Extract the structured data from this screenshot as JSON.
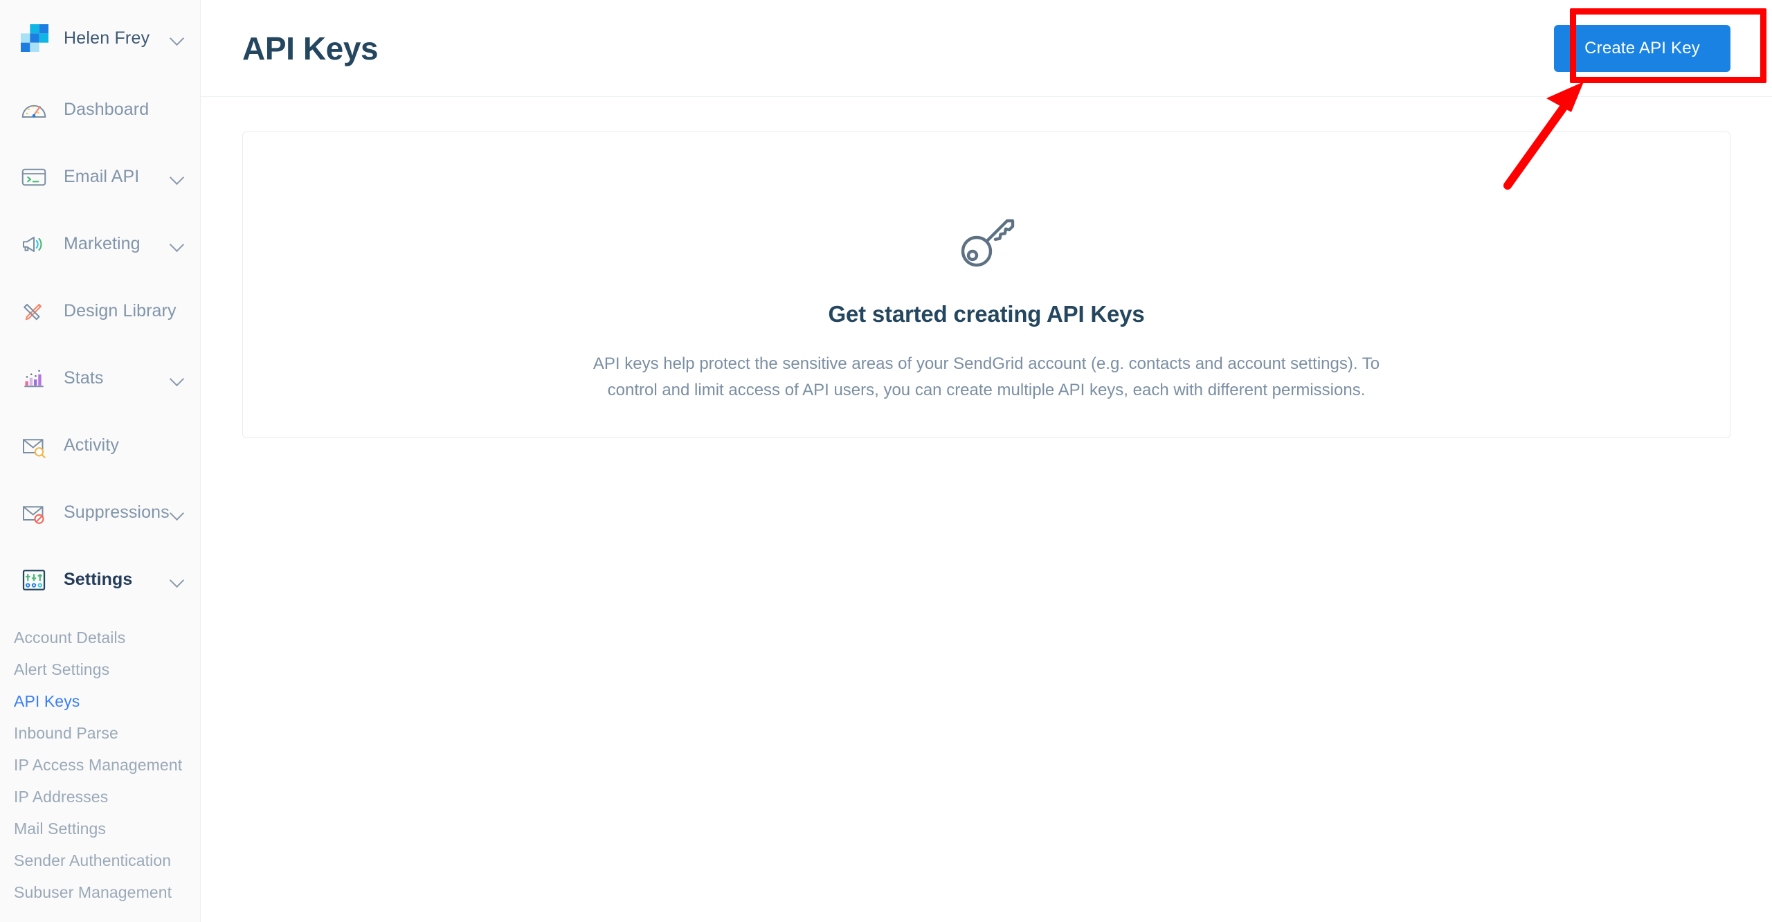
{
  "account": {
    "name": "Helen Frey",
    "logo_icon": "sendgrid-logo-icon",
    "chevron_icon": "chevron-down-icon",
    "logo_colors": [
      "#a8e0f5",
      "#0fb5e5",
      "#1d7de0",
      "#0fb5e5",
      "#1d7de0",
      "#a8e0f5"
    ]
  },
  "sidebar": {
    "items": [
      {
        "label": "Dashboard",
        "icon": "speedometer-icon",
        "expandable": false,
        "active": false
      },
      {
        "label": "Email API",
        "icon": "terminal-window-icon",
        "expandable": true,
        "active": false
      },
      {
        "label": "Marketing",
        "icon": "megaphone-icon",
        "expandable": true,
        "active": false
      },
      {
        "label": "Design Library",
        "icon": "pencil-ruler-icon",
        "expandable": false,
        "active": false
      },
      {
        "label": "Stats",
        "icon": "bar-chart-icon",
        "expandable": true,
        "active": false
      },
      {
        "label": "Activity",
        "icon": "envelope-search-icon",
        "expandable": false,
        "active": false
      },
      {
        "label": "Suppressions",
        "icon": "envelope-blocked-icon",
        "expandable": true,
        "active": false
      },
      {
        "label": "Settings",
        "icon": "sliders-icon",
        "expandable": true,
        "active": true
      }
    ],
    "settings_submenu": [
      {
        "label": "Account Details",
        "current": false
      },
      {
        "label": "Alert Settings",
        "current": false
      },
      {
        "label": "API Keys",
        "current": true
      },
      {
        "label": "Inbound Parse",
        "current": false
      },
      {
        "label": "IP Access Management",
        "current": false
      },
      {
        "label": "IP Addresses",
        "current": false
      },
      {
        "label": "Mail Settings",
        "current": false
      },
      {
        "label": "Sender Authentication",
        "current": false
      },
      {
        "label": "Subuser Management",
        "current": false
      }
    ]
  },
  "header": {
    "title": "API Keys",
    "create_button_label": "Create API Key",
    "create_button_color": "#1a82e2"
  },
  "empty_state": {
    "icon": "key-icon",
    "title": "Get started creating API Keys",
    "body": "API keys help protect the sensitive areas of your SendGrid account (e.g. contacts and account settings). To control and limit access of API users, you can create multiple API keys, each with different permissions."
  },
  "annotations": {
    "highlight_color": "#fe0000",
    "highlight_target": "Create API Key",
    "arrow_icon": "arrow-pointer-icon"
  }
}
